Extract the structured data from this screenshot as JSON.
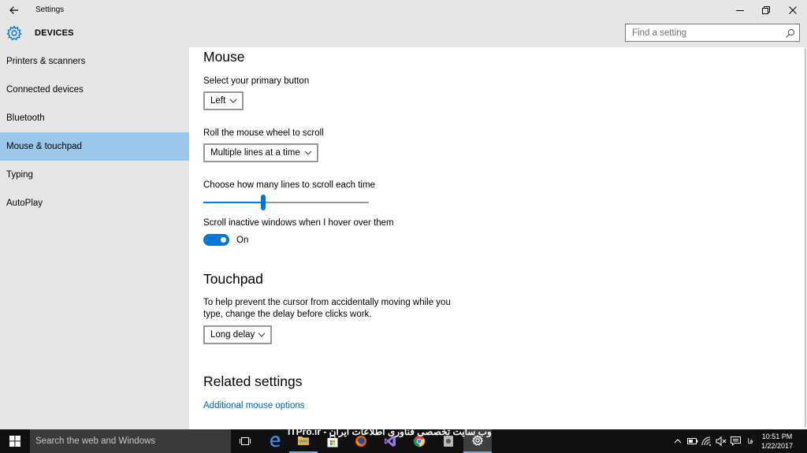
{
  "window": {
    "title": "Settings",
    "section": "DEVICES"
  },
  "search": {
    "placeholder": "Find a setting"
  },
  "sidebar": {
    "items": [
      {
        "label": "Printers & scanners"
      },
      {
        "label": "Connected devices"
      },
      {
        "label": "Bluetooth"
      },
      {
        "label": "Mouse & touchpad",
        "selected": true
      },
      {
        "label": "Typing"
      },
      {
        "label": "AutoPlay"
      }
    ]
  },
  "mouse": {
    "heading": "Mouse",
    "primary_button_label": "Select your primary button",
    "primary_button_value": "Left",
    "wheel_label": "Roll the mouse wheel to scroll",
    "wheel_value": "Multiple lines at a time",
    "lines_label": "Choose how many lines to scroll each time",
    "lines_slider_fraction": 0.36,
    "inactive_label": "Scroll inactive windows when I hover over them",
    "inactive_state": "On"
  },
  "touchpad": {
    "heading": "Touchpad",
    "description_line1": "To help prevent the cursor from accidentally moving while you",
    "description_line2": "type, change the delay before clicks work.",
    "delay_value": "Long delay"
  },
  "related": {
    "heading": "Related settings",
    "link": "Additional mouse options"
  },
  "taskbar": {
    "search_placeholder": "Search the web and Windows",
    "watermark": "ITPro.ir - وب سایت تخصصی فناوری اطلاعات ایران",
    "time": "10:51 PM",
    "date": "1/22/2017",
    "language": "فا"
  },
  "colors": {
    "accent": "#0078d7",
    "selected_item": "#99c8ec",
    "chrome_bg": "#e6e6e6",
    "link": "#0063b1",
    "taskbar_bg": "#101010"
  }
}
